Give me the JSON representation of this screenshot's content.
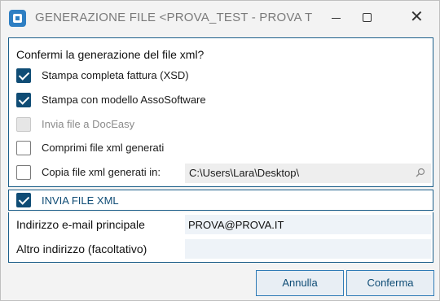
{
  "window": {
    "title": "GENERAZIONE FILE <PROVA_TEST - PROVA TE..."
  },
  "main": {
    "question": "Confermi la generazione del file xml?",
    "options": [
      {
        "label": "Stampa completa fattura (XSD)",
        "checked": true,
        "disabled": false
      },
      {
        "label": "Stampa con modello AssoSoftware",
        "checked": true,
        "disabled": false
      },
      {
        "label": "Invia file a DocEasy",
        "checked": false,
        "disabled": true
      },
      {
        "label": "Comprimi file xml generati",
        "checked": false,
        "disabled": false
      },
      {
        "label": "Copia file xml generati in:",
        "checked": false,
        "disabled": false
      }
    ],
    "copy_path": "C:\\Users\\Lara\\Desktop\\"
  },
  "send": {
    "label": "INVIA FILE XML",
    "checked": true
  },
  "form": {
    "primary_email_label": "Indirizzo e-mail principale",
    "primary_email_value": "PROVA@PROVA.IT",
    "other_email_label": "Altro indirizzo (facoltativo)",
    "other_email_value": ""
  },
  "buttons": {
    "cancel": "Annulla",
    "confirm": "Conferma"
  },
  "colors": {
    "accent": "#0f4c75",
    "panel_border": "#1d5f8a",
    "button_border": "#2f7bb6"
  }
}
